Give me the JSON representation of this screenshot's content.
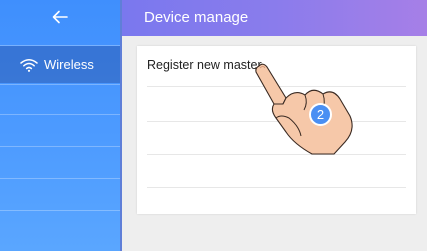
{
  "header": {
    "title": "Device manage"
  },
  "sidebar": {
    "back_icon": "arrow-left-icon",
    "items": [
      {
        "label": "Wireless",
        "icon": "wifi-icon",
        "active": true
      }
    ]
  },
  "main": {
    "items": [
      {
        "label": "Register new master"
      }
    ]
  },
  "overlay": {
    "step_number": "2",
    "hand_icon": "pointing-hand-icon"
  },
  "colors": {
    "sidebar": "#4a96ff",
    "header": "#8a7cec",
    "badge": "#4a8ff3"
  }
}
